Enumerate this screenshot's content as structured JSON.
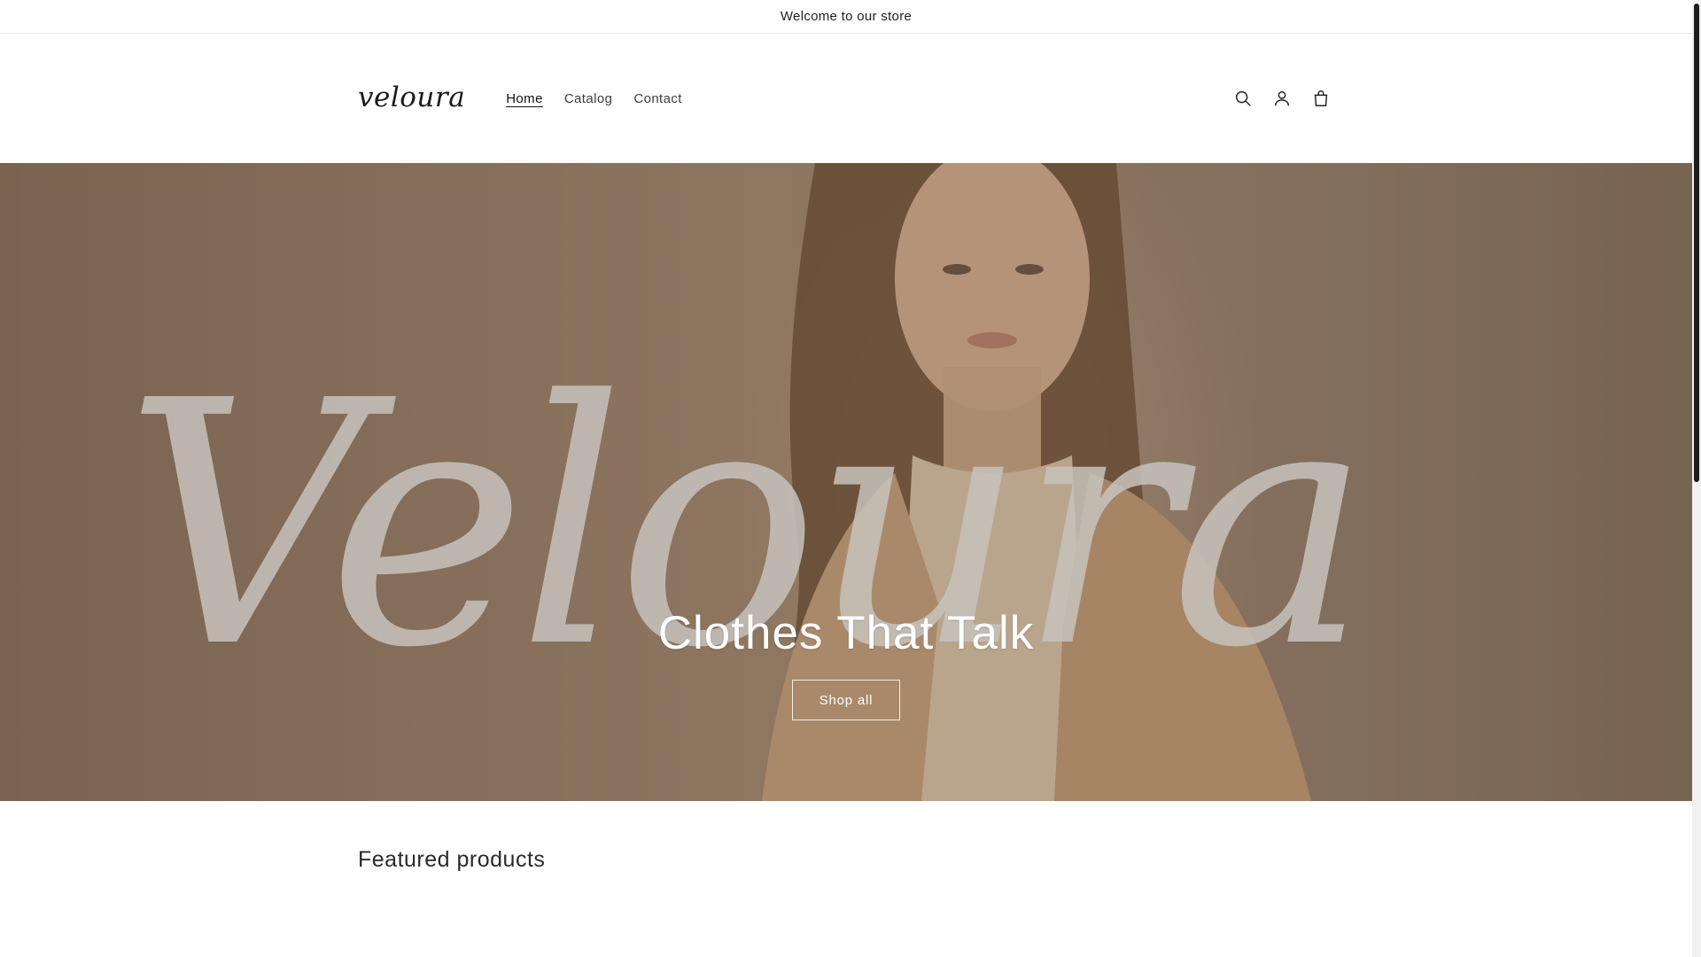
{
  "announcement": {
    "text": "Welcome to our store"
  },
  "header": {
    "logo": "veloura",
    "nav": [
      {
        "label": "Home",
        "active": true
      },
      {
        "label": "Catalog",
        "active": false
      },
      {
        "label": "Contact",
        "active": false
      }
    ],
    "icons": [
      "search-icon",
      "account-icon",
      "cart-icon"
    ]
  },
  "hero": {
    "script_text": "Veloura",
    "title": "Clothes That Talk",
    "button": "Shop all"
  },
  "featured": {
    "title": "Featured products"
  },
  "colors": {
    "hero_base": "#a08670",
    "button_border": "#ffffff",
    "text": "#121212"
  }
}
